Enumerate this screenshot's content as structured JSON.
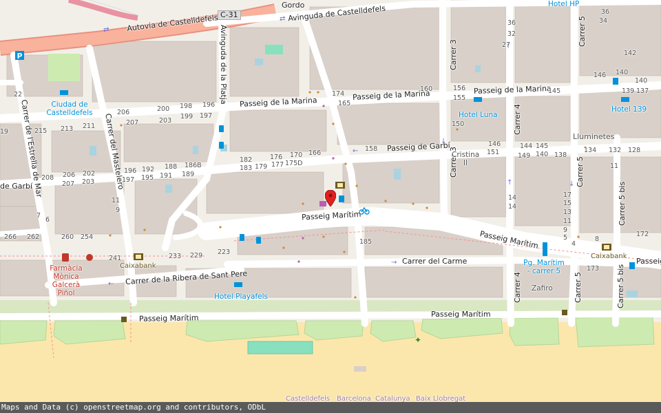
{
  "streets": {
    "autovia": "Autovia de Castelldefels",
    "c31": "C-31",
    "av_castelldefels": "Avinguda de Castelldefels",
    "gordo": "Gordo",
    "av_platja": "Avinguda de la Platja",
    "passeig_marina_1": "Passeig de la Marina",
    "passeig_marina_2": "Passeig de la Marina",
    "passeig_marina_3": "Passeig de la Marina",
    "passeig_garbi_1": "Passeig de Garbí",
    "passeig_garbi_2": "de Garbí",
    "passeig_maritim_1": "Passeig Marítim",
    "passeig_maritim_2": "Passeig Marítim",
    "passeig_maritim_3": "Passeig Marítim",
    "passeig_maritim_4": "Passeig Marítim",
    "passeig_maritim_5": "Passeig Marítim",
    "passeig_right": "Passeig",
    "carrer_estrella": "Carrer de l'Estrella de Mar",
    "carrer_mastelero": "Carrer del Mastelero",
    "carrer_carme": "Carrer del Carme",
    "carrer_ribera": "Carrer de la Ribera de Sant Pere",
    "carrer_3a": "Carrer 3",
    "carrer_3b": "Carrer 3",
    "carrer_4a": "Carrer 4",
    "carrer_4b": "Carrer 4",
    "carrer_5a": "Carrer 5",
    "carrer_5b": "Carrer 5",
    "carrer_5c": "Carrer 5",
    "carrer_5bis_a": "Carrer 5 bis",
    "carrer_5bis_b": "Carrer 5 bis"
  },
  "pois": {
    "ciudad": "Ciudad de Castelldefels",
    "hotel_hp": "Hotel HP",
    "hotel_luna": "Hotel Luna",
    "hotel_139": "Hotel 139",
    "hotel_playafels": "Hotel Playafels",
    "lluminetes": "Lluminetes",
    "cristina": "Cristina II",
    "caixabank_1": "Caixabank",
    "caixabank_2": "Caixabank",
    "farmacia": "Farmàcia Mònica Galcerà Piñol",
    "pg_maritim": "Pg. Marítim - carrer 5",
    "zafiro": "Zafiro"
  },
  "house_numbers": [
    {
      "t": "22"
    },
    {
      "t": "19"
    },
    {
      "t": "215"
    },
    {
      "t": "213"
    },
    {
      "t": "211"
    },
    {
      "t": "207"
    },
    {
      "t": "206"
    },
    {
      "t": "203"
    },
    {
      "t": "200"
    },
    {
      "t": "199"
    },
    {
      "t": "198"
    },
    {
      "t": "197"
    },
    {
      "t": "196"
    },
    {
      "t": "174"
    },
    {
      "t": "165"
    },
    {
      "t": "160"
    },
    {
      "t": "156"
    },
    {
      "t": "155"
    },
    {
      "t": "150"
    },
    {
      "t": "145"
    },
    {
      "t": "146"
    },
    {
      "t": "142"
    },
    {
      "t": "140"
    },
    {
      "t": "140"
    },
    {
      "t": "139"
    },
    {
      "t": "137"
    },
    {
      "t": "36"
    },
    {
      "t": "32"
    },
    {
      "t": "34"
    },
    {
      "t": "36"
    },
    {
      "t": "27"
    },
    {
      "t": "182"
    },
    {
      "t": "183"
    },
    {
      "t": "179"
    },
    {
      "t": "176"
    },
    {
      "t": "177"
    },
    {
      "t": "170"
    },
    {
      "t": "175D"
    },
    {
      "t": "166"
    },
    {
      "t": "158"
    },
    {
      "t": "186B"
    },
    {
      "t": "188"
    },
    {
      "t": "189"
    },
    {
      "t": "192"
    },
    {
      "t": "191"
    },
    {
      "t": "195"
    },
    {
      "t": "196"
    },
    {
      "t": "197"
    },
    {
      "t": "208"
    },
    {
      "t": "206"
    },
    {
      "t": "207"
    },
    {
      "t": "202"
    },
    {
      "t": "203"
    },
    {
      "t": "151"
    },
    {
      "t": "146"
    },
    {
      "t": "144"
    },
    {
      "t": "145"
    },
    {
      "t": "140"
    },
    {
      "t": "149"
    },
    {
      "t": "138"
    },
    {
      "t": "134"
    },
    {
      "t": "132"
    },
    {
      "t": "128"
    },
    {
      "t": "11"
    },
    {
      "t": "11"
    },
    {
      "t": "9"
    },
    {
      "t": "7"
    },
    {
      "t": "6"
    },
    {
      "t": "266"
    },
    {
      "t": "262"
    },
    {
      "t": "260"
    },
    {
      "t": "254"
    },
    {
      "t": "241"
    },
    {
      "t": "233"
    },
    {
      "t": "229"
    },
    {
      "t": "223"
    },
    {
      "t": "185"
    },
    {
      "t": "14"
    },
    {
      "t": "14"
    },
    {
      "t": "17"
    },
    {
      "t": "15"
    },
    {
      "t": "13"
    },
    {
      "t": "11"
    },
    {
      "t": "9"
    },
    {
      "t": "5"
    },
    {
      "t": "4"
    },
    {
      "t": "8"
    },
    {
      "t": "172"
    },
    {
      "t": "173"
    }
  ],
  "admin": {
    "castelldefels": "Castelldefels",
    "barcelona": "Barcelona",
    "catalunya": "Catalunya",
    "baix": "Baix Llobregat"
  },
  "attribution": "Maps and Data (c) openstreetmap.org and contributors, ODbL",
  "marker": {
    "label": "location-marker"
  },
  "colors": {
    "land": "#f2efe9",
    "building": "#d9d0c9",
    "road_major": "#f9b29c",
    "beach": "#fbe7ab",
    "grass": "#cdebb0",
    "water": "#aad3df",
    "pitch": "#88e0be"
  }
}
